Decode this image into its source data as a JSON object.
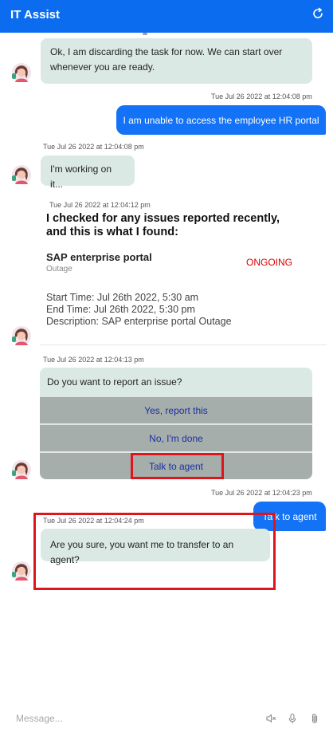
{
  "header": {
    "title": "IT Assist",
    "refresh_icon": "refresh-icon"
  },
  "messages": {
    "m1": {
      "text": "Ok, I am discarding the task for now. We can start over whenever you are ready."
    },
    "m2": {
      "timestamp": "Tue Jul 26 2022 at 12:04:08 pm",
      "text": "I am unable to access the employee HR portal"
    },
    "m3": {
      "timestamp": "Tue Jul 26 2022 at 12:04:08 pm",
      "text": "I'm working on it..."
    },
    "card": {
      "timestamp": "Tue Jul 26 2022 at 12:04:12 pm",
      "headline": "I checked for any issues reported recently, and this is what I found:",
      "service": "SAP enterprise portal",
      "service_type": "Outage",
      "status": "ONGOING",
      "start": "Start Time: Jul 26th 2022, 5:30 am",
      "end": "End Time: Jul 26th 2022, 5:30 pm",
      "description": "Description: SAP enterprise portal Outage"
    },
    "quick_reply": {
      "timestamp": "Tue Jul 26 2022 at 12:04:13 pm",
      "prompt": "Do you want to report an issue?",
      "options": [
        "Yes, report this",
        "No, I'm done",
        "Talk to agent"
      ]
    },
    "m5": {
      "timestamp": "Tue Jul 26 2022 at 12:04:23 pm",
      "text": "Talk to agent"
    },
    "m6": {
      "timestamp": "Tue Jul 26 2022 at 12:04:24 pm",
      "text": "Are you sure, you want me to transfer to an agent?"
    }
  },
  "composer": {
    "placeholder": "Message...",
    "icons": [
      "mute-icon",
      "microphone-icon",
      "attachment-icon"
    ]
  },
  "colors": {
    "header": "#0b6cf0",
    "user_bubble": "#1372f5",
    "bot_bubble": "#dbe9e4",
    "option_button": "#a6aeab",
    "option_text": "#1a2fa3",
    "status": "#d90000",
    "highlight": "#e0141b"
  }
}
